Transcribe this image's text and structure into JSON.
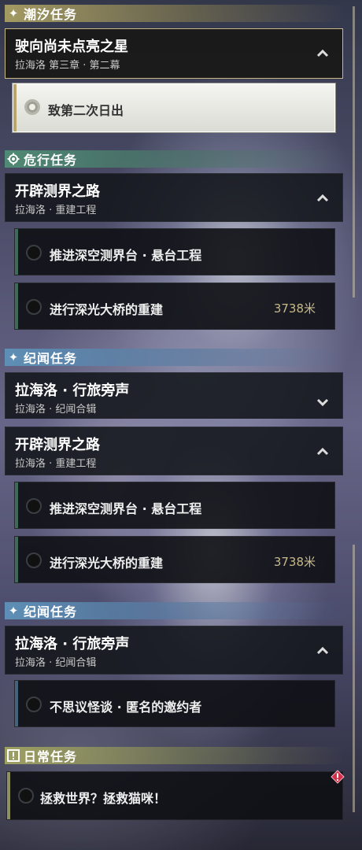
{
  "sections": {
    "tidal": {
      "label": "潮汐任务",
      "icon": "sparkle-icon"
    },
    "danger": {
      "label": "危行任务",
      "icon": "gear-icon"
    },
    "chronicle": {
      "label": "纪闻任务",
      "icon": "sparkle-icon"
    },
    "daily": {
      "label": "日常任务",
      "icon": "exclamation-box-icon"
    }
  },
  "quests": {
    "star": {
      "title": "驶向尚未点亮之星",
      "subtitle": "拉海洛 第三章 · 第二幕",
      "step": "致第二次日出"
    },
    "road": {
      "title": "开辟测界之路",
      "subtitle": "拉海洛 · 重建工程",
      "steps": [
        {
          "label": "推进深空测界台 · 悬台工程",
          "distance": ""
        },
        {
          "label": "进行深光大桥的重建",
          "distance": "3738米"
        }
      ]
    },
    "voices": {
      "title": "拉海洛 · 行旅旁声",
      "subtitle": "拉海洛 · 纪闻合辑",
      "step": "不思议怪谈 · 匿名的邀约者"
    },
    "cat": {
      "step": "拯救世界？拯救猫咪！"
    }
  },
  "colors": {
    "accent_gold": "#c8b984",
    "tidal": "#a39a62",
    "danger": "#4f8a74",
    "chronicle": "#5e8fb6",
    "daily": "#9ea062",
    "distance_text": "#c8b98a",
    "warn": "#d0304a"
  }
}
